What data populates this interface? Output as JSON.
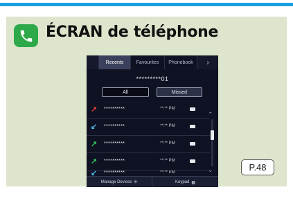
{
  "card": {
    "title": "ÉCRAN de téléphone",
    "icon": "phone-handset-icon",
    "page_ref": "P.48"
  },
  "screen": {
    "tabs": [
      {
        "label": "Recents",
        "active": true
      },
      {
        "label": "Favourites",
        "active": false
      },
      {
        "label": "Phonebook",
        "active": false
      }
    ],
    "more_icon": "chevron-right-icon",
    "number": "*********01",
    "filters": {
      "all": "All",
      "missed": "Missed",
      "selected": "All"
    },
    "calls": [
      {
        "type": "missed",
        "icon": "missed-call-icon",
        "name": "**********",
        "time": "**:** PM"
      },
      {
        "type": "incoming",
        "icon": "incoming-call-icon",
        "name": "**********",
        "time": "**:** PM"
      },
      {
        "type": "outgoing",
        "icon": "outgoing-call-icon",
        "name": "**********",
        "time": "**:** PM"
      },
      {
        "type": "outgoing",
        "icon": "outgoing-call-icon",
        "name": "**********",
        "time": "**:** PM"
      },
      {
        "type": "incoming",
        "icon": "incoming-call-icon",
        "name": "**********",
        "time": "**:** PM"
      }
    ],
    "bottom": {
      "manage": "Manage Devices",
      "keypad": "Keypad"
    }
  },
  "colors": {
    "accent": "#1ba1e2",
    "card_bg": "#dde5cc",
    "screen_bg": "#0e1222",
    "missed": "#e23b3b",
    "incoming": "#4db6e6",
    "outgoing": "#36c35a"
  }
}
